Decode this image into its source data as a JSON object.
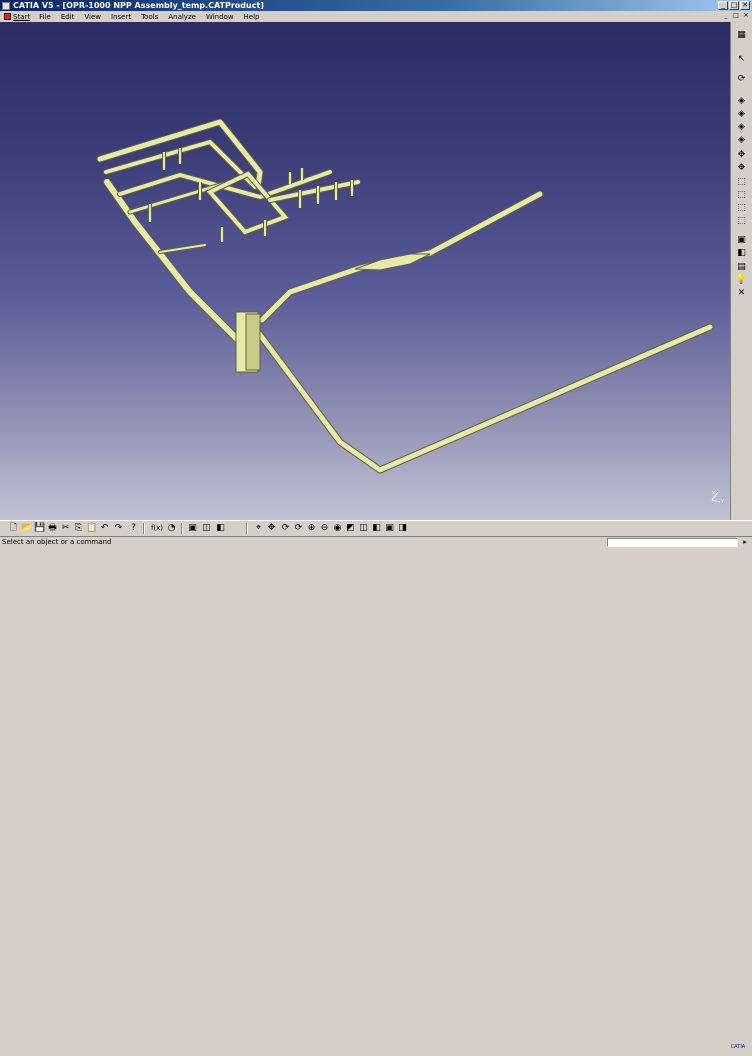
{
  "window": {
    "title": "CATIA V5 - [OPR-1000 NPP Assembly_temp.CATProduct]",
    "buttons": {
      "minimize": "_",
      "maximize": "□",
      "close": "✕"
    }
  },
  "menubar": {
    "start": "Start",
    "items": [
      "File",
      "Edit",
      "View",
      "Insert",
      "Tools",
      "Analyze",
      "Window",
      "Help"
    ],
    "doc_controls": [
      "_",
      "□",
      "✕"
    ]
  },
  "right_toolbar": {
    "icons": [
      "tree-icon",
      "pointer-icon",
      "spin-icon",
      "assembly-1-icon",
      "assembly-2-icon",
      "assembly-3-icon",
      "assembly-4-icon",
      "move-icon",
      "snap-icon",
      "constraint-1-icon",
      "constraint-2-icon",
      "constraint-3-icon",
      "constraint-4-icon",
      "scene-1-icon",
      "scene-2-icon",
      "scene-3-icon",
      "bulb-icon",
      "cross-icon"
    ],
    "glyphs": [
      "▦",
      "↖",
      "⟳",
      "◈",
      "◈",
      "◈",
      "◈",
      "✥",
      "✥",
      "⬚",
      "⬚",
      "⬚",
      "⬚",
      "▣",
      "◧",
      "▤",
      "💡",
      "✕"
    ]
  },
  "bottom_toolbar": {
    "glyphs": [
      "🗋",
      "📂",
      "💾",
      "🖶",
      "✂",
      "⎘",
      "📋",
      "↶",
      "↷",
      "?",
      "f(x)",
      "◔",
      "▣",
      "◫",
      "◧",
      "⌖",
      "✥",
      "⟳",
      "⊕",
      "⊖",
      "◉",
      "◩",
      "◫",
      "◧",
      "▣",
      "◨"
    ]
  },
  "status": {
    "message": "Select an object or a command",
    "command_value": ""
  },
  "compass": {
    "x": "x",
    "y": "y"
  },
  "logo": {
    "line1": "CATIA"
  }
}
